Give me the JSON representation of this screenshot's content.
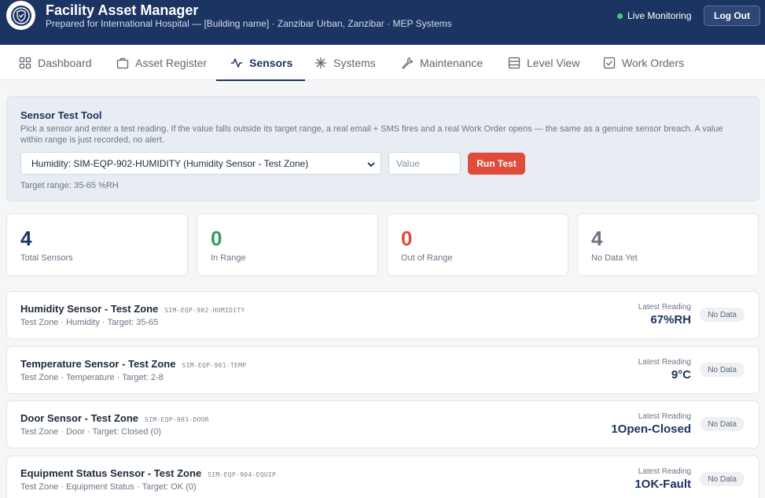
{
  "header": {
    "title": "Facility Asset Manager",
    "subtitle": "Prepared for International Hospital — [Building name] · Zanzibar Urban, Zanzibar · MEP Systems",
    "live_label": "Live Monitoring",
    "logout_label": "Log Out"
  },
  "nav": {
    "tabs": [
      {
        "label": "Dashboard",
        "icon": "grid-icon"
      },
      {
        "label": "Asset Register",
        "icon": "briefcase-icon"
      },
      {
        "label": "Sensors",
        "icon": "activity-icon",
        "active": true
      },
      {
        "label": "Systems",
        "icon": "snowflake-icon"
      },
      {
        "label": "Maintenance",
        "icon": "wrench-icon"
      },
      {
        "label": "Level View",
        "icon": "list-icon"
      },
      {
        "label": "Work Orders",
        "icon": "checkbox-icon"
      }
    ]
  },
  "test_tool": {
    "title": "Sensor Test Tool",
    "description": "Pick a sensor and enter a test reading. If the value falls outside its target range, a real email + SMS fires and a real Work Order opens — the same as a genuine sensor breach. A value within range is just recorded, no alert.",
    "selected_sensor": "Humidity: SIM-EQP-902-HUMIDITY (Humidity Sensor - Test Zone)",
    "value_placeholder": "Value",
    "run_label": "Run Test",
    "target_range": "Target range: 35-65 %RH"
  },
  "stats": [
    {
      "value": "4",
      "label": "Total Sensors",
      "color": "#1c3462"
    },
    {
      "value": "0",
      "label": "In Range",
      "color": "#2e9e5b"
    },
    {
      "value": "0",
      "label": "Out of Range",
      "color": "#e04b3b"
    },
    {
      "value": "4",
      "label": "No Data Yet",
      "color": "#6a7584"
    }
  ],
  "sensors": [
    {
      "name": "Humidity Sensor - Test Zone",
      "code": "SIM-EQP-902-HUMIDITY",
      "meta": "Test Zone · Humidity · Target: 35-65",
      "reading_label": "Latest Reading",
      "reading": "67%RH",
      "status": "No Data"
    },
    {
      "name": "Temperature Sensor - Test Zone",
      "code": "SIM-EQP-901-TEMP",
      "meta": "Test Zone · Temperature · Target: 2-8",
      "reading_label": "Latest Reading",
      "reading": "9°C",
      "status": "No Data"
    },
    {
      "name": "Door Sensor - Test Zone",
      "code": "SIM-EQP-903-DOOR",
      "meta": "Test Zone · Door · Target: Closed (0)",
      "reading_label": "Latest Reading",
      "reading": "1Open-Closed",
      "status": "No Data"
    },
    {
      "name": "Equipment Status Sensor - Test Zone",
      "code": "SIM-EQP-904-EQUIP",
      "meta": "Test Zone · Equipment Status · Target: OK (0)",
      "reading_label": "Latest Reading",
      "reading": "1OK-Fault",
      "status": "No Data"
    }
  ]
}
